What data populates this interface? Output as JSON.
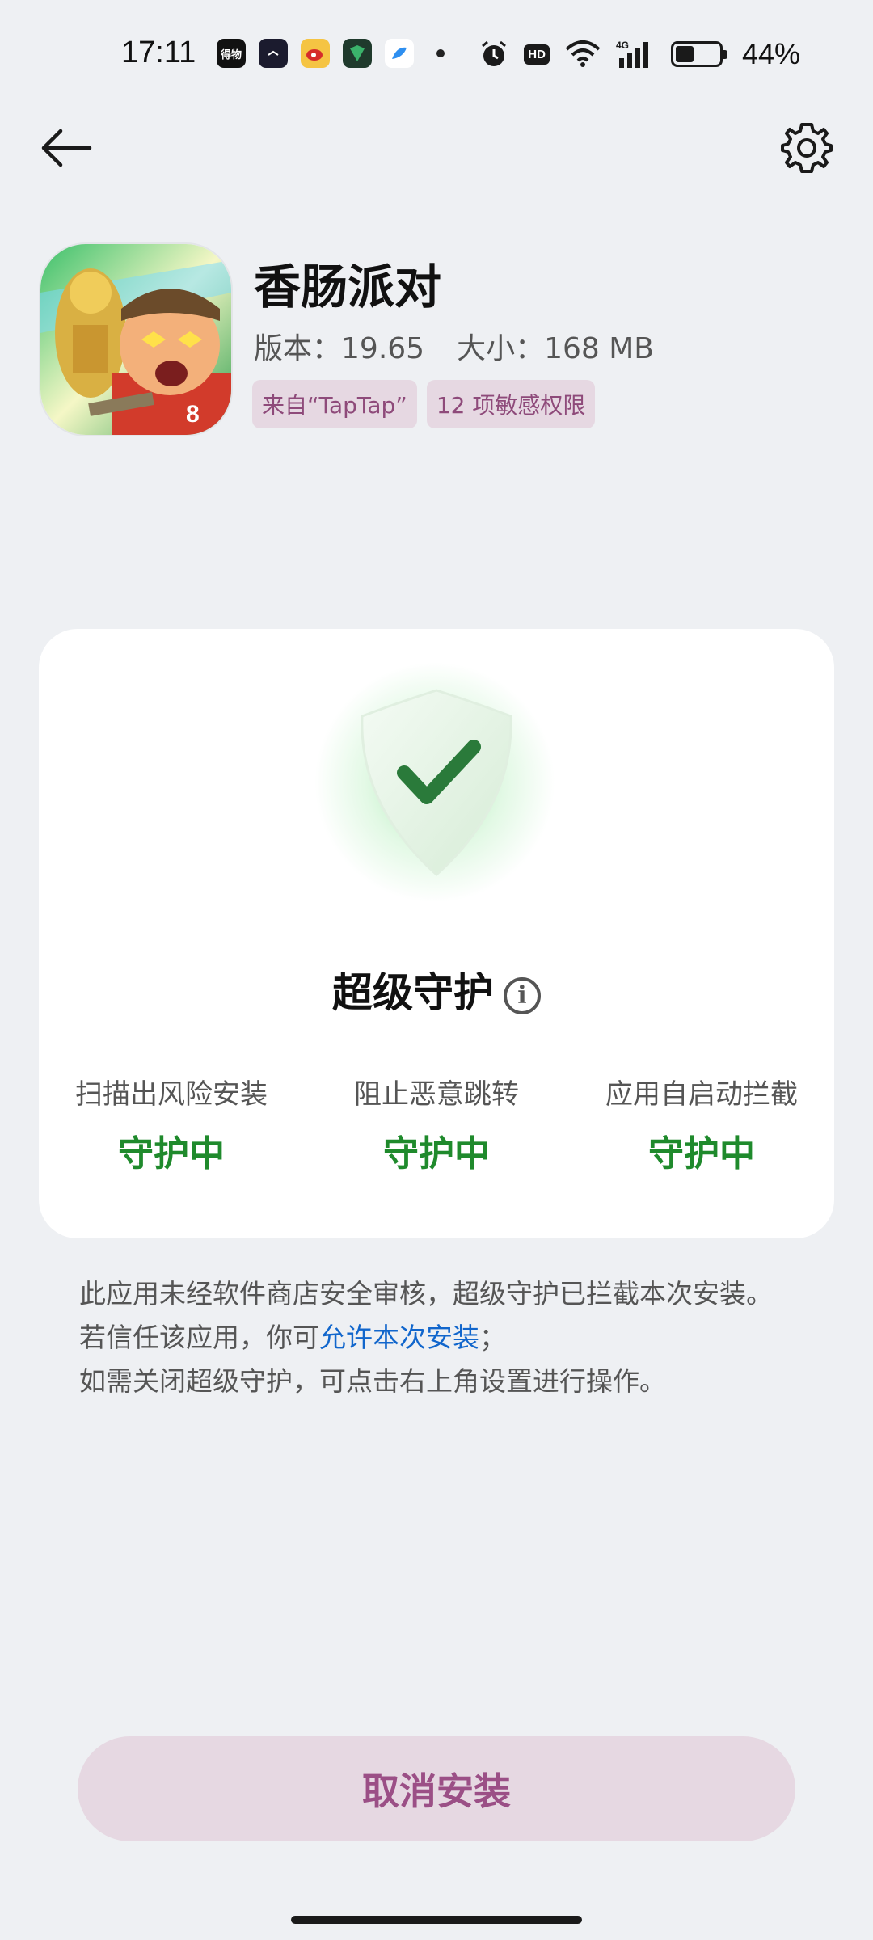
{
  "status_bar": {
    "time": "17:11",
    "hd": "HD",
    "network": "4G",
    "battery_pct": "44%",
    "battery_level": 0.44,
    "notification_icons": [
      "dewu-app-icon",
      "clock-app-icon",
      "weibo-app-icon",
      "security-app-icon",
      "bird-app-icon"
    ]
  },
  "nav": {
    "back_icon": "arrow-left-icon",
    "settings_icon": "gear-icon"
  },
  "app": {
    "name": "香肠派对",
    "version_label": "版本：",
    "version": "19.65",
    "size_label": "大小：",
    "size": "168 MB",
    "tags": [
      "来自“TapTap”",
      "12 项敏感权限"
    ]
  },
  "protection_card": {
    "title": "超级守护",
    "shield_icon": "shield-check-icon",
    "info_icon": "info-icon",
    "features": [
      {
        "label": "扫描出风险安装",
        "status": "守护中"
      },
      {
        "label": "阻止恶意跳转",
        "status": "守护中"
      },
      {
        "label": "应用自启动拦截",
        "status": "守护中"
      }
    ]
  },
  "notice": {
    "text_before_link": "此应用未经软件商店安全审核，超级守护已拦截本次安装。若信任该应用，你可",
    "link": "允许本次安装",
    "text_after_link": "；",
    "line2": "如需关闭超级守护，可点击右上角设置进行操作。"
  },
  "actions": {
    "cancel_label": "取消安装"
  },
  "colors": {
    "accent_green": "#1f8a2c",
    "link_blue": "#1166cc",
    "button_bg": "#e6d8e2",
    "button_text": "#9b4f86"
  }
}
